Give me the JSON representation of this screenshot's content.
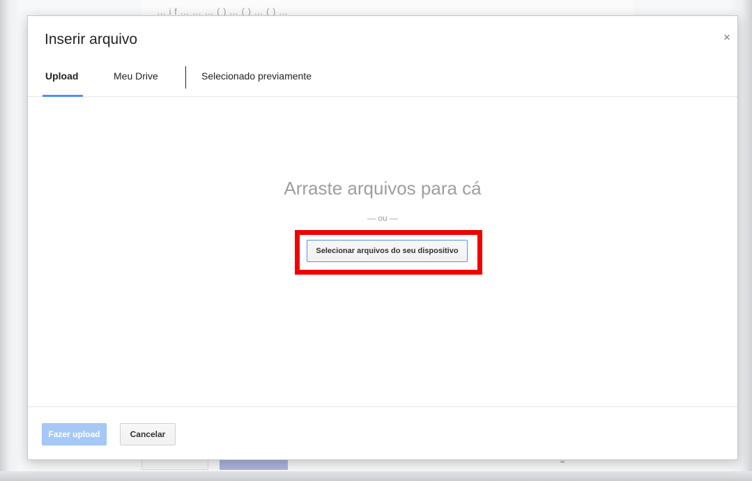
{
  "background": {
    "page_text": "… i  f   …   …   … ( )   … ( )   … ( )   …"
  },
  "dialog": {
    "title": "Inserir arquivo",
    "close_icon": "×"
  },
  "tabs": [
    {
      "label": "Upload",
      "selected": true
    },
    {
      "label": "Meu Drive",
      "selected": false
    },
    {
      "label": "Selecionado previamente",
      "selected": false
    }
  ],
  "dropzone": {
    "title": "Arraste arquivos para cá",
    "or_text": "— ou —",
    "select_button": "Selecionar arquivos do seu dispositivo"
  },
  "footer": {
    "upload_button": "Fazer upload",
    "cancel_button": "Cancelar"
  },
  "colors": {
    "accent": "#4d90fe",
    "highlight": "#f10000",
    "disabled_primary": "#a5c8f7"
  }
}
